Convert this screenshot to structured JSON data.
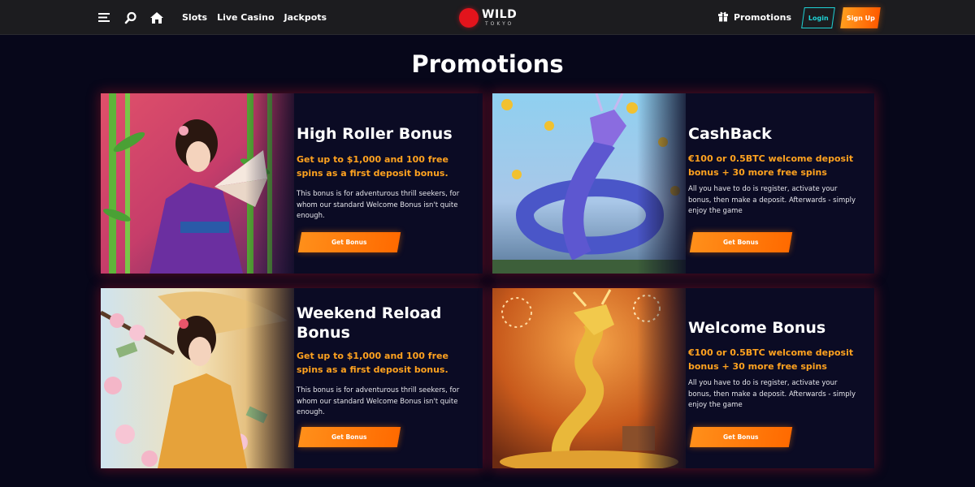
{
  "header": {
    "menu_icon": "hamburger-menu-icon",
    "search_icon": "search-icon",
    "home_icon": "home-icon",
    "nav": [
      "Slots",
      "Live Casino",
      "Jackpots"
    ],
    "logo": {
      "name": "WILD",
      "sub": "TOKYO"
    },
    "promotions_icon": "gift-icon",
    "promotions_label": "Promotions",
    "login_label": "Login",
    "signup_label": "Sign Up"
  },
  "page_title": "Promotions",
  "colors": {
    "accent_orange": "#ffa21f",
    "button_orange": "#ff7a00",
    "login_cyan": "#1fd3d6",
    "logo_red": "#e3141c",
    "background": "#07071a"
  },
  "promotions": [
    {
      "title": "High Roller Bonus",
      "highlight": "Get up to $1,000 and 100 free spins as a first deposit bonus.",
      "description": "This bonus is for adventurous thrill seekers, for whom our standard Welcome Bonus isn't quite enough.",
      "button": "Get Bonus"
    },
    {
      "title": "CashBack",
      "highlight": "€100 or 0.5BTC welcome deposit bonus + 30 more free spins",
      "description": "All you have to do is register, activate your bonus, then make a deposit. Afterwards - simply enjoy the game",
      "button": "Get Bonus"
    },
    {
      "title": "Weekend Reload Bonus",
      "highlight": "Get up to $1,000 and 100 free spins as a first deposit bonus.",
      "description": "This bonus is for adventurous thrill seekers, for whom our standard Welcome Bonus isn't quite enough.",
      "button": "Get Bonus"
    },
    {
      "title": "Welcome Bonus",
      "highlight": "€100 or 0.5BTC welcome deposit bonus + 30 more free spins",
      "description": "All you have to do is register, activate your bonus, then make a deposit. Afterwards - simply enjoy the game",
      "button": "Get Bonus"
    }
  ]
}
